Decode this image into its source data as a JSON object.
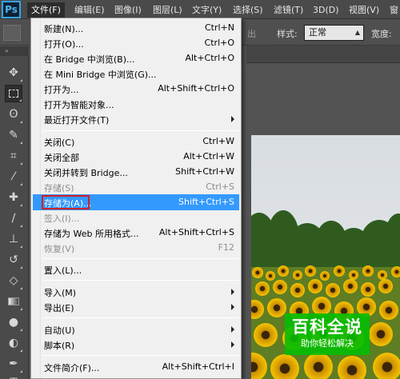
{
  "app": {
    "logo": "Ps"
  },
  "menubar": {
    "items": [
      "文件(F)",
      "编辑(E)",
      "图像(I)",
      "图层(L)",
      "文字(Y)",
      "选择(S)",
      "滤镜(T)",
      "3D(D)",
      "视图(V)",
      "窗"
    ],
    "active_index": 0
  },
  "options_bar": {
    "partial_left": "出",
    "style_label": "样式:",
    "style_value": "正常",
    "width_label": "宽度:"
  },
  "file_menu": {
    "items": [
      {
        "label": "新建(N)...",
        "shortcut": "Ctrl+N"
      },
      {
        "label": "打开(O)...",
        "shortcut": "Ctrl+O"
      },
      {
        "label": "在 Bridge 中浏览(B)...",
        "shortcut": "Alt+Ctrl+O"
      },
      {
        "label": "在 Mini Bridge 中浏览(G)...",
        "shortcut": ""
      },
      {
        "label": "打开为...",
        "shortcut": "Alt+Shift+Ctrl+O"
      },
      {
        "label": "打开为智能对象...",
        "shortcut": ""
      },
      {
        "label": "最近打开文件(T)",
        "shortcut": "",
        "submenu": true
      },
      {
        "label": "关闭(C)",
        "shortcut": "Ctrl+W"
      },
      {
        "label": "关闭全部",
        "shortcut": "Alt+Ctrl+W"
      },
      {
        "label": "关闭并转到 Bridge...",
        "shortcut": "Shift+Ctrl+W"
      },
      {
        "label": "存储(S)",
        "shortcut": "Ctrl+S",
        "disabled": true
      },
      {
        "label": "存储为(A)...",
        "shortcut": "Shift+Ctrl+S",
        "highlighted": true
      },
      {
        "label": "签入(I)...",
        "shortcut": "",
        "disabled": true
      },
      {
        "label": "存储为 Web 所用格式...",
        "shortcut": "Alt+Shift+Ctrl+S"
      },
      {
        "label": "恢复(V)",
        "shortcut": "F12",
        "disabled": true
      },
      {
        "label": "置入(L)...",
        "shortcut": ""
      },
      {
        "label": "导入(M)",
        "shortcut": "",
        "submenu": true
      },
      {
        "label": "导出(E)",
        "shortcut": "",
        "submenu": true
      },
      {
        "label": "自动(U)",
        "shortcut": "",
        "submenu": true
      },
      {
        "label": "脚本(R)",
        "shortcut": "",
        "submenu": true
      },
      {
        "label": "文件简介(F)...",
        "shortcut": "Alt+Shift+Ctrl+I"
      }
    ]
  },
  "watermark": {
    "title": "百科全说",
    "subtitle": "助你轻松解决"
  },
  "colors": {
    "menu_highlight": "#3399ff",
    "annotation_box": "#d2202b",
    "watermark": "#04be02"
  }
}
